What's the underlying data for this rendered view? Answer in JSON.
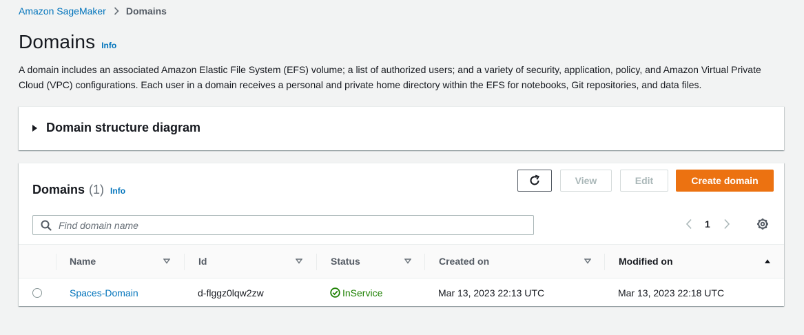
{
  "breadcrumb": {
    "root": "Amazon SageMaker",
    "current": "Domains"
  },
  "page": {
    "title": "Domains",
    "info": "Info",
    "description": "A domain includes an associated Amazon Elastic File System (EFS) volume; a list of authorized users; and a variety of security, application, policy, and Amazon Virtual Private Cloud (VPC) configurations. Each user in a domain receives a personal and private home directory within the EFS for notebooks, Git repositories, and data files."
  },
  "diagram_panel": {
    "title": "Domain structure diagram",
    "expanded": false
  },
  "domains_panel": {
    "title": "Domains",
    "count": "(1)",
    "info": "Info",
    "buttons": {
      "refresh_icon": "refresh-icon",
      "view": "View",
      "edit": "Edit",
      "create": "Create domain"
    },
    "search": {
      "placeholder": "Find domain name",
      "value": ""
    },
    "pagination": {
      "current_page": "1"
    },
    "columns": [
      {
        "label": "Name",
        "sort": "none"
      },
      {
        "label": "Id",
        "sort": "none"
      },
      {
        "label": "Status",
        "sort": "none"
      },
      {
        "label": "Created on",
        "sort": "none"
      },
      {
        "label": "Modified on",
        "sort": "ascending"
      }
    ],
    "rows": [
      {
        "name": "Spaces-Domain",
        "id": "d-flggz0lqw2zw",
        "status": "InService",
        "created_on": "Mar 13, 2023 22:13 UTC",
        "modified_on": "Mar 13, 2023 22:18 UTC",
        "selected": false
      }
    ]
  },
  "colors": {
    "link": "#0073bb",
    "primary_button": "#ec7211",
    "status_success": "#1d8102",
    "background": "#f2f3f3"
  }
}
